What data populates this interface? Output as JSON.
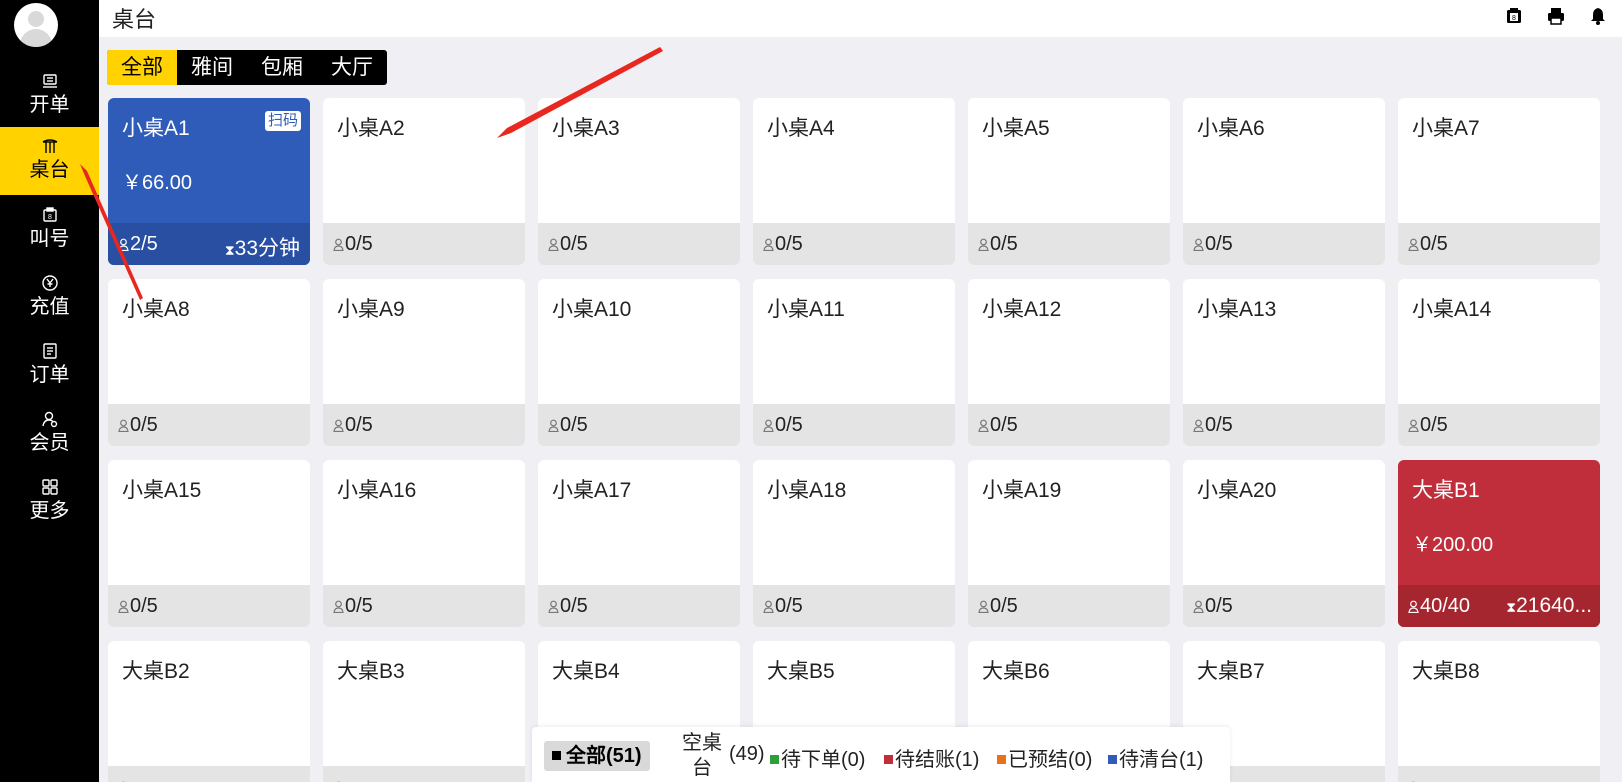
{
  "sidebar": {
    "items": [
      {
        "label": "开单",
        "icon": "cashier-icon",
        "active": false
      },
      {
        "label": "桌台",
        "icon": "table-icon",
        "active": true
      },
      {
        "label": "叫号",
        "icon": "call-number-icon",
        "active": false
      },
      {
        "label": "充值",
        "icon": "yen-coin-icon",
        "active": false
      },
      {
        "label": "订单",
        "icon": "order-list-icon",
        "active": false
      },
      {
        "label": "会员",
        "icon": "member-icon",
        "active": false
      },
      {
        "label": "更多",
        "icon": "grid-more-icon",
        "active": false
      }
    ]
  },
  "header": {
    "title": "桌台",
    "icons": [
      "queue-printer-icon",
      "printer-icon",
      "bell-icon"
    ]
  },
  "tabs": [
    {
      "label": "全部",
      "active": true
    },
    {
      "label": "雅间",
      "active": false
    },
    {
      "label": "包厢",
      "active": false
    },
    {
      "label": "大厅",
      "active": false
    }
  ],
  "tables": [
    {
      "name": "小桌A1",
      "state": "blue",
      "price": "￥66.00",
      "guests": "2/5",
      "timer": "33分钟",
      "badge": "扫码"
    },
    {
      "name": "小桌A2",
      "guests": "0/5"
    },
    {
      "name": "小桌A3",
      "guests": "0/5"
    },
    {
      "name": "小桌A4",
      "guests": "0/5"
    },
    {
      "name": "小桌A5",
      "guests": "0/5"
    },
    {
      "name": "小桌A6",
      "guests": "0/5"
    },
    {
      "name": "小桌A7",
      "guests": "0/5"
    },
    {
      "name": "小桌A8",
      "guests": "0/5"
    },
    {
      "name": "小桌A9",
      "guests": "0/5"
    },
    {
      "name": "小桌A10",
      "guests": "0/5"
    },
    {
      "name": "小桌A11",
      "guests": "0/5"
    },
    {
      "name": "小桌A12",
      "guests": "0/5"
    },
    {
      "name": "小桌A13",
      "guests": "0/5"
    },
    {
      "name": "小桌A14",
      "guests": "0/5"
    },
    {
      "name": "小桌A15",
      "guests": "0/5"
    },
    {
      "name": "小桌A16",
      "guests": "0/5"
    },
    {
      "name": "小桌A17",
      "guests": "0/5"
    },
    {
      "name": "小桌A18",
      "guests": "0/5"
    },
    {
      "name": "小桌A19",
      "guests": "0/5"
    },
    {
      "name": "小桌A20",
      "guests": "0/5"
    },
    {
      "name": "大桌B1",
      "state": "red",
      "price": "￥200.00",
      "guests": "40/40",
      "timer": "21640..."
    },
    {
      "name": "大桌B2",
      "guests": ""
    },
    {
      "name": "大桌B3",
      "guests": ""
    },
    {
      "name": "大桌B4",
      "guests": ""
    },
    {
      "name": "大桌B5",
      "guests": ""
    },
    {
      "name": "大桌B6",
      "guests": ""
    },
    {
      "name": "大桌B7",
      "guests": ""
    },
    {
      "name": "大桌B8",
      "guests": ""
    }
  ],
  "legend": {
    "all": "全部(51)",
    "empty_label": "空桌台",
    "empty_count": "(49)",
    "items": [
      {
        "label": "待下单(0)",
        "color": "#2e9e3a"
      },
      {
        "label": "待结账(1)",
        "color": "#bf2e3a"
      },
      {
        "label": "已预结(0)",
        "color": "#e8721c"
      },
      {
        "label": "待清台(1)",
        "color": "#2f5cb8"
      }
    ]
  },
  "colors": {
    "accent": "#ffd200",
    "occupied_blue": "#2f5cb8",
    "checkout_red": "#bf2e3a"
  }
}
